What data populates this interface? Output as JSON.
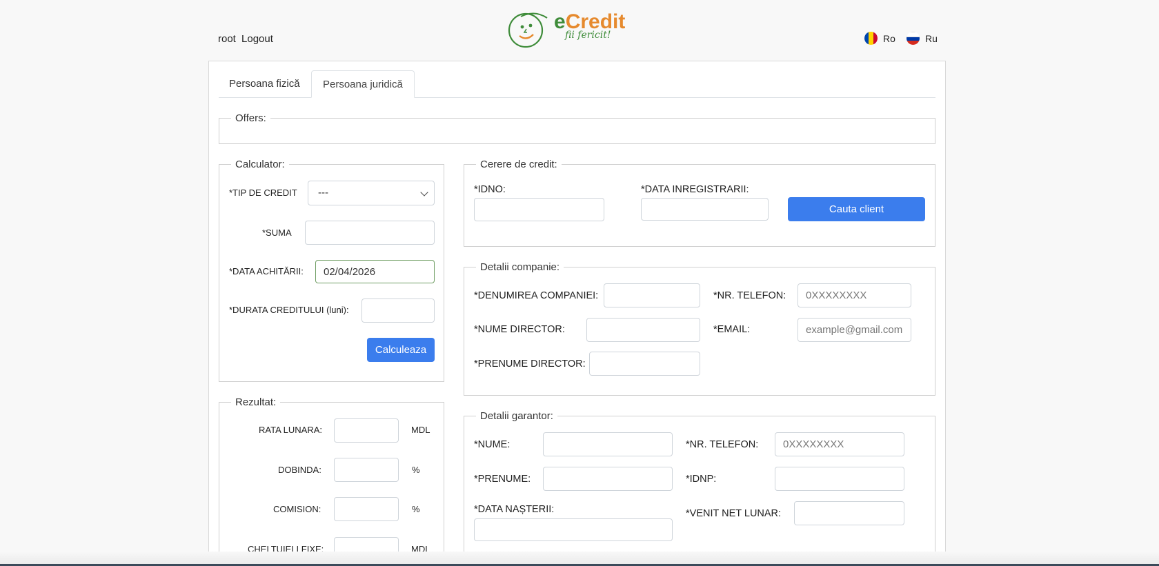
{
  "header": {
    "username": "root",
    "logout_label": "Logout",
    "logo_text_e": "e",
    "logo_text_credit": "Credit",
    "logo_tagline": "fii fericit!",
    "languages": [
      {
        "label": "Ro",
        "flag": "moldova-flag-icon"
      },
      {
        "label": "Ru",
        "flag": "russia-flag-icon"
      }
    ]
  },
  "tabs": [
    "Persoana fizică",
    "Persoana juridică"
  ],
  "active_tab": "Persoana juridică",
  "offers": {
    "legend": "Offers:"
  },
  "calculator": {
    "legend": "Calculator:",
    "tip_credit_label": "*TIP DE CREDIT",
    "tip_credit_value": "---",
    "suma_label": "*SUMA",
    "data_achitarii_label": "*DATA ACHITĂRII:",
    "data_achitarii_value": "02/04/2026",
    "durata_label": "*DURATA CREDITULUI (luni):",
    "calc_button": "Calculeaza"
  },
  "rezultat": {
    "legend": "Rezultat:",
    "rows": [
      {
        "label": "RATA LUNARA:",
        "unit": "MDL"
      },
      {
        "label": "DOBINDA:",
        "unit": "%"
      },
      {
        "label": "COMISION:",
        "unit": "%"
      },
      {
        "label": "CHELTUIELI FIXE:",
        "unit": "MDL"
      }
    ]
  },
  "cerere": {
    "legend": "Cerere de credit:",
    "idno_label": "*IDNO:",
    "data_inreg_label": "*DATA INREGISTRARII:",
    "search_button": "Cauta client"
  },
  "companie": {
    "legend": "Detalii companie:",
    "denumire_label": "*DENUMIREA COMPANIEI:",
    "telefon_label": "*NR. TELEFON:",
    "telefon_placeholder": "0XXXXXXXX",
    "nume_director_label": "*NUME DIRECTOR:",
    "email_label": "*EMAIL:",
    "email_placeholder": "example@gmail.com",
    "prenume_director_label": "*PRENUME DIRECTOR:"
  },
  "garantor": {
    "legend": "Detalii garantor:",
    "nume_label": "*NUME:",
    "telefon_label": "*NR. TELEFON:",
    "telefon_placeholder": "0XXXXXXXX",
    "prenume_label": "*PRENUME:",
    "idnp_label": "*IDNP:",
    "data_nasterii_label": "*DATA NAȘTERII:",
    "venit_label": "*VENIT NET LUNAR:"
  },
  "colors": {
    "primary_button": "#3b7ded",
    "logo_green": "#3f8c3a",
    "logo_orange": "#e68a2e"
  }
}
